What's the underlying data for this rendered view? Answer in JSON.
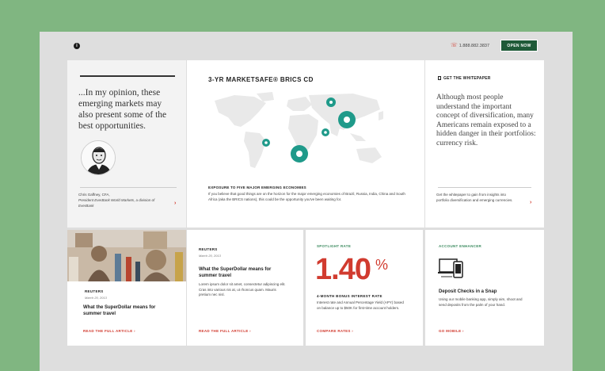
{
  "header": {
    "phone": "1.888.882.3837",
    "open_now": "OPEN NOW"
  },
  "hero_quote": {
    "quote": "...In my opinion, these emerging markets may also present some of the best opportunities.",
    "name": "Chris Gaffney, CFA,",
    "role": "President EverBank World Markets, a division of EverBank"
  },
  "hero_product": {
    "title": "3-YR MARKETSAFE® BRICS CD",
    "subtitle": "EXPOSURE TO FIVE MAJOR EMERGING ECONOMIES",
    "description": "If you believe that good things are on the horizon for the major emerging economies of Brazil, Russia, India, China and South Africa (aka the BRICS nations), this could be the opportunity you've been waiting for."
  },
  "hero_whitepaper": {
    "label": "GET THE WHITEPAPER",
    "text": "Although most people understand the important concept of diversification, many Americans remain exposed to a hidden danger in their portfolios: currency risk.",
    "footer": "Get the whitepaper to gain from insights into portfolio diversification and emerging currencies."
  },
  "tiles": {
    "news1": {
      "source": "REUTERS",
      "date": "March 20, 2013",
      "headline": "What the SuperDollar means for summer travel",
      "link": "READ THE FULL ARTICLE"
    },
    "news2": {
      "source": "REUTERS",
      "date": "March 20, 2013",
      "headline": "What the SuperDollar means for summer travel",
      "body": "Lorem ipsum dolor sit amet, consectetur adipiscing elit. Cras into various nis at, ut rhoncus quam. Mauris pretium nec nisl.",
      "link": "READ THE FULL ARTICLE"
    },
    "rate": {
      "label": "SPOTLIGHT RATE",
      "value": "1.40",
      "pct": "%",
      "title": "4-MONTH BONUS INTEREST RATE",
      "body": "Interest rate and Annual Percentage Yield (APY) based on balance up to $50K for first-time account holders.",
      "link": "COMPARE RATES"
    },
    "account": {
      "label": "ACCOUNT ENHANCER",
      "headline": "Deposit Checks in a Snap",
      "body": "Using our mobile banking app, simply aim, shoot and send deposits from the palm of your hand.",
      "link": "GO MOBILE"
    }
  },
  "colors": {
    "background": "#80b681",
    "brand_green": "#1f5a38",
    "accent_red": "#d13b2f",
    "teal_marker": "#1f9a8a"
  }
}
